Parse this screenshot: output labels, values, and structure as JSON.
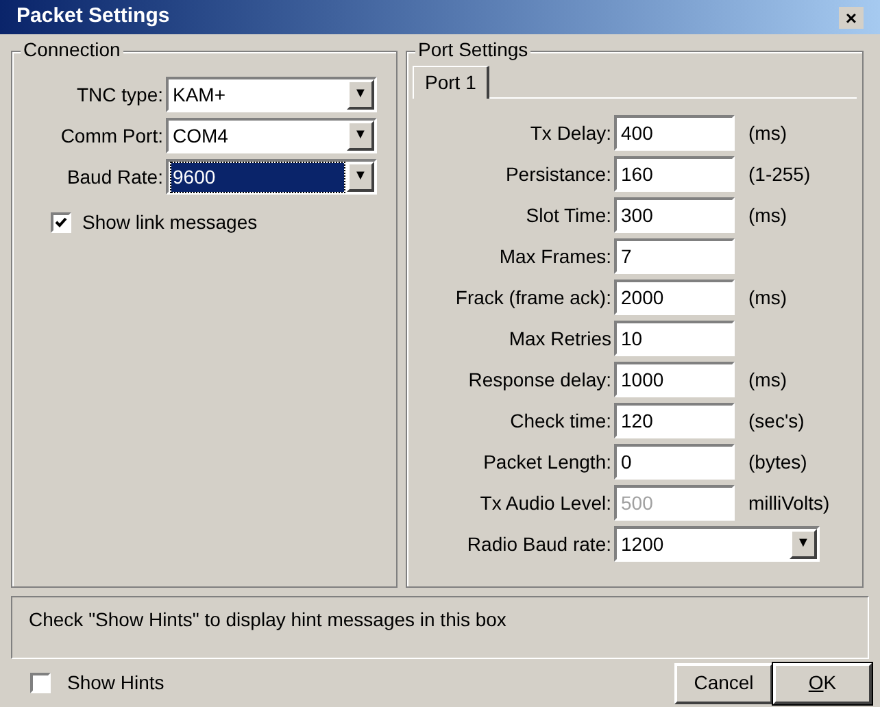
{
  "window": {
    "title": "Packet Settings",
    "close": "×"
  },
  "connection": {
    "title": "Connection",
    "fields": [
      {
        "label": "TNC type:",
        "value": "KAM+",
        "selected": false,
        "arrow": "▼"
      },
      {
        "label": "Comm Port:",
        "value": "COM4",
        "selected": false,
        "arrow": "▼"
      },
      {
        "label": "Baud Rate:",
        "value": "9600",
        "selected": true,
        "arrow": "▼"
      }
    ],
    "show_link": {
      "label": "Show link messages",
      "checked": true
    }
  },
  "port_settings": {
    "title": "Port Settings",
    "tabs": [
      {
        "label": "Port 1",
        "selected": true
      }
    ],
    "fields": [
      {
        "kind": "text",
        "label": "Tx Delay:",
        "value": "400",
        "unit": "(ms)"
      },
      {
        "kind": "text",
        "label": "Persistance:",
        "value": "160",
        "unit": "(1-255)"
      },
      {
        "kind": "text",
        "label": "Slot Time:",
        "value": "300",
        "unit": "(ms)"
      },
      {
        "kind": "text",
        "label": "Max Frames:",
        "value": "7"
      },
      {
        "kind": "text",
        "label": "Frack (frame ack):",
        "value": "2000",
        "unit": "(ms)"
      },
      {
        "kind": "text",
        "label": "Max Retries",
        "value": "10"
      },
      {
        "kind": "text",
        "label": "Response delay:",
        "value": "1000",
        "unit": "(ms)"
      },
      {
        "kind": "text",
        "label": "Check time:",
        "value": "120",
        "unit": "(sec's)"
      },
      {
        "kind": "text",
        "label": "Packet Length:",
        "value": "0",
        "unit": "(bytes)"
      },
      {
        "kind": "text",
        "label": "Tx Audio Level:",
        "value": "500",
        "unit": "milliVolts)",
        "disabled": true
      },
      {
        "kind": "dropdown",
        "label": "Radio Baud rate:",
        "value": "1200",
        "arrow": "▼"
      }
    ]
  },
  "hint_box": {
    "text": "Check \"Show Hints\" to display hint messages in this box"
  },
  "show_hints": {
    "label": "Show Hints",
    "checked": false
  },
  "buttons": [
    {
      "label": "Cancel",
      "default": false
    },
    {
      "label": "OK",
      "default": true
    }
  ]
}
